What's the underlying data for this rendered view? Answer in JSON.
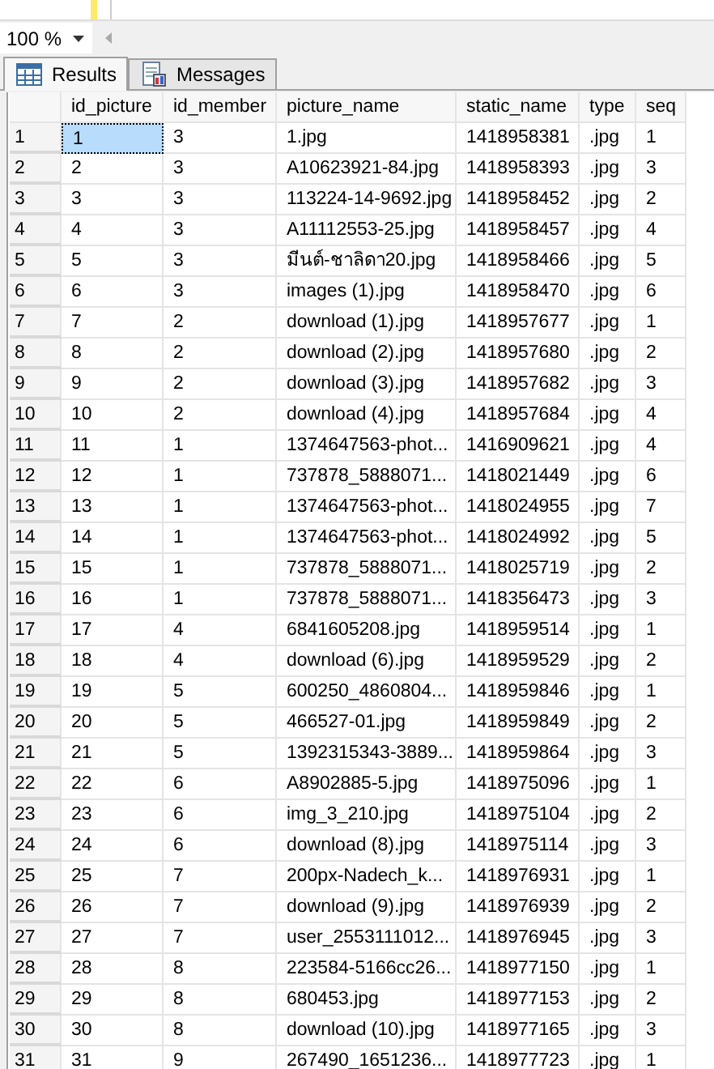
{
  "zoom": {
    "value": "100 %"
  },
  "tabs": [
    {
      "label": "Results",
      "selected": true,
      "kind": "grid"
    },
    {
      "label": "Messages",
      "selected": false,
      "kind": "messages"
    }
  ],
  "table": {
    "columns": [
      "id_picture",
      "id_member",
      "picture_name",
      "static_name",
      "type",
      "seq"
    ],
    "rows": [
      {
        "row_number": "1",
        "cells": [
          {
            "text": "1",
            "selected": true
          },
          {
            "text": "3",
            "selected": false
          },
          {
            "text": "1.jpg",
            "selected": false
          },
          {
            "text": "1418958381",
            "selected": false
          },
          {
            "text": ".jpg",
            "selected": false
          },
          {
            "text": "1",
            "selected": false
          }
        ]
      },
      {
        "row_number": "2",
        "cells": [
          {
            "text": "2",
            "selected": false
          },
          {
            "text": "3",
            "selected": false
          },
          {
            "text": "A10623921-84.jpg",
            "selected": false
          },
          {
            "text": "1418958393",
            "selected": false
          },
          {
            "text": ".jpg",
            "selected": false
          },
          {
            "text": "3",
            "selected": false
          }
        ]
      },
      {
        "row_number": "3",
        "cells": [
          {
            "text": "3",
            "selected": false
          },
          {
            "text": "3",
            "selected": false
          },
          {
            "text": "113224-14-9692.jpg",
            "selected": false
          },
          {
            "text": "1418958452",
            "selected": false
          },
          {
            "text": ".jpg",
            "selected": false
          },
          {
            "text": "2",
            "selected": false
          }
        ]
      },
      {
        "row_number": "4",
        "cells": [
          {
            "text": "4",
            "selected": false
          },
          {
            "text": "3",
            "selected": false
          },
          {
            "text": "A11112553-25.jpg",
            "selected": false
          },
          {
            "text": "1418958457",
            "selected": false
          },
          {
            "text": ".jpg",
            "selected": false
          },
          {
            "text": "4",
            "selected": false
          }
        ]
      },
      {
        "row_number": "5",
        "cells": [
          {
            "text": "5",
            "selected": false
          },
          {
            "text": "3",
            "selected": false
          },
          {
            "text": "มีนต์-ชาลิดา20.jpg",
            "selected": false
          },
          {
            "text": "1418958466",
            "selected": false
          },
          {
            "text": ".jpg",
            "selected": false
          },
          {
            "text": "5",
            "selected": false
          }
        ]
      },
      {
        "row_number": "6",
        "cells": [
          {
            "text": "6",
            "selected": false
          },
          {
            "text": "3",
            "selected": false
          },
          {
            "text": "images (1).jpg",
            "selected": false
          },
          {
            "text": "1418958470",
            "selected": false
          },
          {
            "text": ".jpg",
            "selected": false
          },
          {
            "text": "6",
            "selected": false
          }
        ]
      },
      {
        "row_number": "7",
        "cells": [
          {
            "text": "7",
            "selected": false
          },
          {
            "text": "2",
            "selected": false
          },
          {
            "text": "download (1).jpg",
            "selected": false
          },
          {
            "text": "1418957677",
            "selected": false
          },
          {
            "text": ".jpg",
            "selected": false
          },
          {
            "text": "1",
            "selected": false
          }
        ]
      },
      {
        "row_number": "8",
        "cells": [
          {
            "text": "8",
            "selected": false
          },
          {
            "text": "2",
            "selected": false
          },
          {
            "text": "download (2).jpg",
            "selected": false
          },
          {
            "text": "1418957680",
            "selected": false
          },
          {
            "text": ".jpg",
            "selected": false
          },
          {
            "text": "2",
            "selected": false
          }
        ]
      },
      {
        "row_number": "9",
        "cells": [
          {
            "text": "9",
            "selected": false
          },
          {
            "text": "2",
            "selected": false
          },
          {
            "text": "download (3).jpg",
            "selected": false
          },
          {
            "text": "1418957682",
            "selected": false
          },
          {
            "text": ".jpg",
            "selected": false
          },
          {
            "text": "3",
            "selected": false
          }
        ]
      },
      {
        "row_number": "10",
        "cells": [
          {
            "text": "10",
            "selected": false
          },
          {
            "text": "2",
            "selected": false
          },
          {
            "text": "download (4).jpg",
            "selected": false
          },
          {
            "text": "1418957684",
            "selected": false
          },
          {
            "text": ".jpg",
            "selected": false
          },
          {
            "text": "4",
            "selected": false
          }
        ]
      },
      {
        "row_number": "11",
        "cells": [
          {
            "text": "11",
            "selected": false
          },
          {
            "text": "1",
            "selected": false
          },
          {
            "text": "1374647563-phot...",
            "selected": false
          },
          {
            "text": "1416909621",
            "selected": false
          },
          {
            "text": ".jpg",
            "selected": false
          },
          {
            "text": "4",
            "selected": false
          }
        ]
      },
      {
        "row_number": "12",
        "cells": [
          {
            "text": "12",
            "selected": false
          },
          {
            "text": "1",
            "selected": false
          },
          {
            "text": "737878_5888071...",
            "selected": false
          },
          {
            "text": "1418021449",
            "selected": false
          },
          {
            "text": ".jpg",
            "selected": false
          },
          {
            "text": "6",
            "selected": false
          }
        ]
      },
      {
        "row_number": "13",
        "cells": [
          {
            "text": "13",
            "selected": false
          },
          {
            "text": "1",
            "selected": false
          },
          {
            "text": "1374647563-phot...",
            "selected": false
          },
          {
            "text": "1418024955",
            "selected": false
          },
          {
            "text": ".jpg",
            "selected": false
          },
          {
            "text": "7",
            "selected": false
          }
        ]
      },
      {
        "row_number": "14",
        "cells": [
          {
            "text": "14",
            "selected": false
          },
          {
            "text": "1",
            "selected": false
          },
          {
            "text": "1374647563-phot...",
            "selected": false
          },
          {
            "text": "1418024992",
            "selected": false
          },
          {
            "text": ".jpg",
            "selected": false
          },
          {
            "text": "5",
            "selected": false
          }
        ]
      },
      {
        "row_number": "15",
        "cells": [
          {
            "text": "15",
            "selected": false
          },
          {
            "text": "1",
            "selected": false
          },
          {
            "text": "737878_5888071...",
            "selected": false
          },
          {
            "text": "1418025719",
            "selected": false
          },
          {
            "text": ".jpg",
            "selected": false
          },
          {
            "text": "2",
            "selected": false
          }
        ]
      },
      {
        "row_number": "16",
        "cells": [
          {
            "text": "16",
            "selected": false
          },
          {
            "text": "1",
            "selected": false
          },
          {
            "text": "737878_5888071...",
            "selected": false
          },
          {
            "text": "1418356473",
            "selected": false
          },
          {
            "text": ".jpg",
            "selected": false
          },
          {
            "text": "3",
            "selected": false
          }
        ]
      },
      {
        "row_number": "17",
        "cells": [
          {
            "text": "17",
            "selected": false
          },
          {
            "text": "4",
            "selected": false
          },
          {
            "text": "6841605208.jpg",
            "selected": false
          },
          {
            "text": "1418959514",
            "selected": false
          },
          {
            "text": ".jpg",
            "selected": false
          },
          {
            "text": "1",
            "selected": false
          }
        ]
      },
      {
        "row_number": "18",
        "cells": [
          {
            "text": "18",
            "selected": false
          },
          {
            "text": "4",
            "selected": false
          },
          {
            "text": "download (6).jpg",
            "selected": false
          },
          {
            "text": "1418959529",
            "selected": false
          },
          {
            "text": ".jpg",
            "selected": false
          },
          {
            "text": "2",
            "selected": false
          }
        ]
      },
      {
        "row_number": "19",
        "cells": [
          {
            "text": "19",
            "selected": false
          },
          {
            "text": "5",
            "selected": false
          },
          {
            "text": "600250_4860804...",
            "selected": false
          },
          {
            "text": "1418959846",
            "selected": false
          },
          {
            "text": ".jpg",
            "selected": false
          },
          {
            "text": "1",
            "selected": false
          }
        ]
      },
      {
        "row_number": "20",
        "cells": [
          {
            "text": "20",
            "selected": false
          },
          {
            "text": "5",
            "selected": false
          },
          {
            "text": "466527-01.jpg",
            "selected": false
          },
          {
            "text": "1418959849",
            "selected": false
          },
          {
            "text": ".jpg",
            "selected": false
          },
          {
            "text": "2",
            "selected": false
          }
        ]
      },
      {
        "row_number": "21",
        "cells": [
          {
            "text": "21",
            "selected": false
          },
          {
            "text": "5",
            "selected": false
          },
          {
            "text": "1392315343-3889...",
            "selected": false
          },
          {
            "text": "1418959864",
            "selected": false
          },
          {
            "text": ".jpg",
            "selected": false
          },
          {
            "text": "3",
            "selected": false
          }
        ]
      },
      {
        "row_number": "22",
        "cells": [
          {
            "text": "22",
            "selected": false
          },
          {
            "text": "6",
            "selected": false
          },
          {
            "text": "A8902885-5.jpg",
            "selected": false
          },
          {
            "text": "1418975096",
            "selected": false
          },
          {
            "text": ".jpg",
            "selected": false
          },
          {
            "text": "1",
            "selected": false
          }
        ]
      },
      {
        "row_number": "23",
        "cells": [
          {
            "text": "23",
            "selected": false
          },
          {
            "text": "6",
            "selected": false
          },
          {
            "text": "img_3_210.jpg",
            "selected": false
          },
          {
            "text": "1418975104",
            "selected": false
          },
          {
            "text": ".jpg",
            "selected": false
          },
          {
            "text": "2",
            "selected": false
          }
        ]
      },
      {
        "row_number": "24",
        "cells": [
          {
            "text": "24",
            "selected": false
          },
          {
            "text": "6",
            "selected": false
          },
          {
            "text": "download (8).jpg",
            "selected": false
          },
          {
            "text": "1418975114",
            "selected": false
          },
          {
            "text": ".jpg",
            "selected": false
          },
          {
            "text": "3",
            "selected": false
          }
        ]
      },
      {
        "row_number": "25",
        "cells": [
          {
            "text": "25",
            "selected": false
          },
          {
            "text": "7",
            "selected": false
          },
          {
            "text": "200px-Nadech_k...",
            "selected": false
          },
          {
            "text": "1418976931",
            "selected": false
          },
          {
            "text": ".jpg",
            "selected": false
          },
          {
            "text": "1",
            "selected": false
          }
        ]
      },
      {
        "row_number": "26",
        "cells": [
          {
            "text": "26",
            "selected": false
          },
          {
            "text": "7",
            "selected": false
          },
          {
            "text": "download (9).jpg",
            "selected": false
          },
          {
            "text": "1418976939",
            "selected": false
          },
          {
            "text": ".jpg",
            "selected": false
          },
          {
            "text": "2",
            "selected": false
          }
        ]
      },
      {
        "row_number": "27",
        "cells": [
          {
            "text": "27",
            "selected": false
          },
          {
            "text": "7",
            "selected": false
          },
          {
            "text": "user_2553111012...",
            "selected": false
          },
          {
            "text": "1418976945",
            "selected": false
          },
          {
            "text": ".jpg",
            "selected": false
          },
          {
            "text": "3",
            "selected": false
          }
        ]
      },
      {
        "row_number": "28",
        "cells": [
          {
            "text": "28",
            "selected": false
          },
          {
            "text": "8",
            "selected": false
          },
          {
            "text": "223584-5166cc26...",
            "selected": false
          },
          {
            "text": "1418977150",
            "selected": false
          },
          {
            "text": ".jpg",
            "selected": false
          },
          {
            "text": "1",
            "selected": false
          }
        ]
      },
      {
        "row_number": "29",
        "cells": [
          {
            "text": "29",
            "selected": false
          },
          {
            "text": "8",
            "selected": false
          },
          {
            "text": "680453.jpg",
            "selected": false
          },
          {
            "text": "1418977153",
            "selected": false
          },
          {
            "text": ".jpg",
            "selected": false
          },
          {
            "text": "2",
            "selected": false
          }
        ]
      },
      {
        "row_number": "30",
        "cells": [
          {
            "text": "30",
            "selected": false
          },
          {
            "text": "8",
            "selected": false
          },
          {
            "text": "download (10).jpg",
            "selected": false
          },
          {
            "text": "1418977165",
            "selected": false
          },
          {
            "text": ".jpg",
            "selected": false
          },
          {
            "text": "3",
            "selected": false
          }
        ]
      },
      {
        "row_number": "31",
        "cells": [
          {
            "text": "31",
            "selected": false
          },
          {
            "text": "9",
            "selected": false
          },
          {
            "text": "267490_1651236...",
            "selected": false
          },
          {
            "text": "1418977723",
            "selected": false
          },
          {
            "text": ".jpg",
            "selected": false
          },
          {
            "text": "1",
            "selected": false
          }
        ]
      }
    ]
  }
}
